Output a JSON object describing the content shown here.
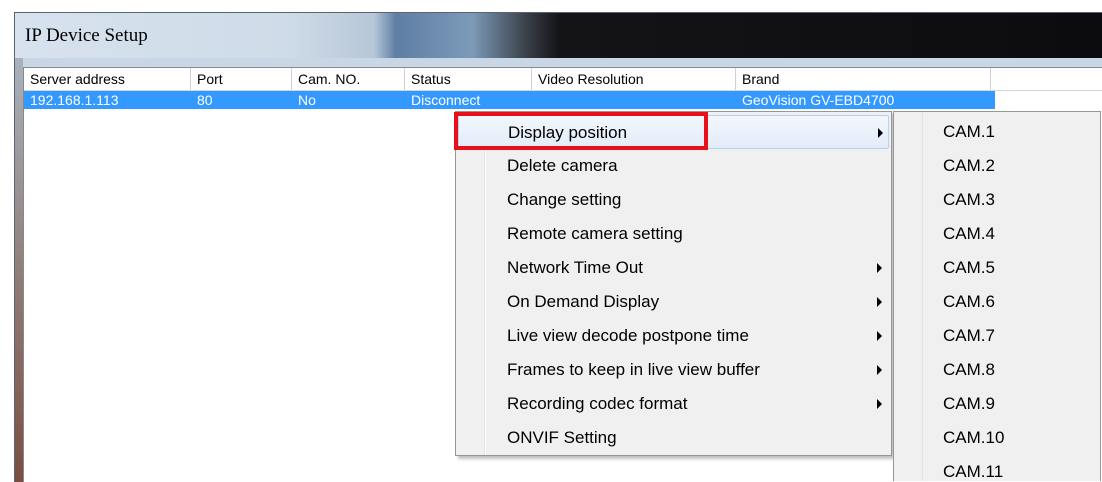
{
  "window": {
    "title": "IP Device Setup"
  },
  "columns": [
    "Server address",
    "Port",
    "Cam. NO.",
    "Status",
    "Video Resolution",
    "Brand"
  ],
  "rows": [
    {
      "server_address": "192.168.1.113",
      "port": "80",
      "cam_no": "No",
      "status": "Disconnect",
      "video_resolution": "",
      "brand": "GeoVision GV-EBD4700"
    }
  ],
  "context_menu": {
    "items": [
      {
        "label": "Display position",
        "has_submenu": true,
        "highlighted": true
      },
      {
        "label": "Delete camera",
        "has_submenu": false
      },
      {
        "label": "Change setting",
        "has_submenu": false
      },
      {
        "label": "Remote camera setting",
        "has_submenu": false
      },
      {
        "label": "Network Time Out",
        "has_submenu": true
      },
      {
        "label": "On Demand Display",
        "has_submenu": true
      },
      {
        "label": "Live view decode postpone time",
        "has_submenu": true
      },
      {
        "label": "Frames to keep in live view buffer",
        "has_submenu": true
      },
      {
        "label": "Recording codec format",
        "has_submenu": true
      },
      {
        "label": "ONVIF Setting",
        "has_submenu": false
      }
    ]
  },
  "submenu": {
    "items": [
      "CAM.1",
      "CAM.2",
      "CAM.3",
      "CAM.4",
      "CAM.5",
      "CAM.6",
      "CAM.7",
      "CAM.8",
      "CAM.9",
      "CAM.10",
      "CAM.11"
    ]
  },
  "colors": {
    "selection": "#3399ff",
    "highlight_box": "#e8101a",
    "menu_bg": "#f0f0f0"
  }
}
